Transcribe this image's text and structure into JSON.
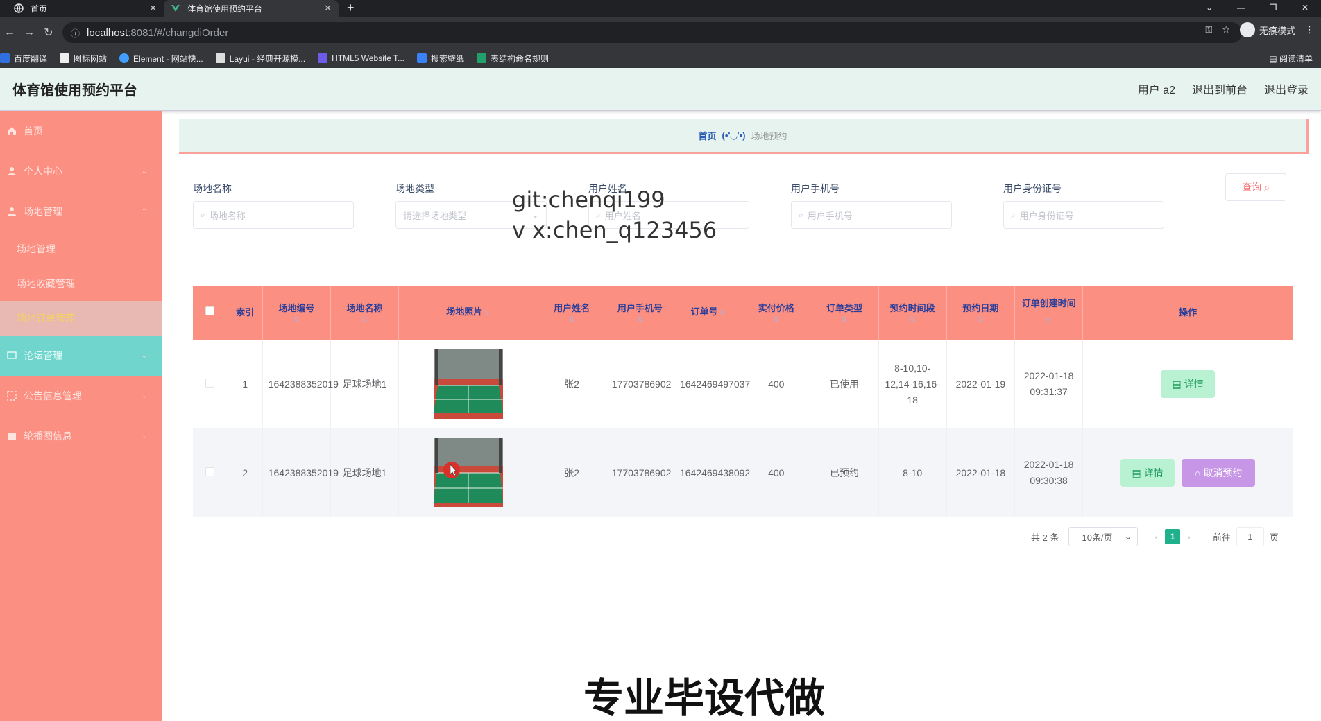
{
  "browser": {
    "tabs": [
      {
        "title": "首页",
        "active": false
      },
      {
        "title": "体育馆使用预约平台",
        "active": true
      }
    ],
    "url_host": "localhost",
    "url_path": ":8081/#/changdiOrder",
    "incognito_label": "无痕模式",
    "bookmarks": [
      "百度翻译",
      "图标网站",
      "Element - 网站快...",
      "Layui - 经典开源模...",
      "HTML5 Website T...",
      "搜索壁纸",
      "表结构命名规则"
    ],
    "reading_list": "阅读清单"
  },
  "header": {
    "title": "体育馆使用预约平台",
    "user": "用户 a2",
    "front_link": "退出到前台",
    "logout_link": "退出登录"
  },
  "sidebar": {
    "home": "首页",
    "personal": "个人中心",
    "venue_mgmt": "场地管理",
    "sub_venue": "场地管理",
    "sub_fav": "场地收藏管理",
    "sub_order": "场地订单管理",
    "forum": "论坛管理",
    "notice": "公告信息管理",
    "carousel": "轮播图信息"
  },
  "breadcrumb": {
    "home": "首页",
    "sep": "(•'◡'•)",
    "current": "场地预约"
  },
  "filters": [
    {
      "label": "场地名称",
      "placeholder": "场地名称"
    },
    {
      "label": "场地类型",
      "placeholder": "请选择场地类型"
    },
    {
      "label": "用户姓名",
      "placeholder": "用户姓名"
    },
    {
      "label": "用户手机号",
      "placeholder": "用户手机号"
    },
    {
      "label": "用户身份证号",
      "placeholder": "用户身份证号"
    }
  ],
  "query_button": "查询",
  "watermark": {
    "line1": "git:chenqi199",
    "line2": "v x:chen_q123456"
  },
  "bottom_mark": "专业毕设代做",
  "table": {
    "headers": [
      "索引",
      "场地编号",
      "场地名称",
      "场地照片",
      "用户姓名",
      "用户手机号",
      "订单号",
      "实付价格",
      "订单类型",
      "预约时间段",
      "预约日期",
      "订单创建时间",
      "操作"
    ],
    "rows": [
      {
        "index": "1",
        "code": "1642388352019",
        "name": "足球场地1",
        "user": "张2",
        "phone": "17703786902",
        "order_no": "1642469497037",
        "price": "400",
        "type": "已使用",
        "slot": "8-10,10-12,14-16,16-18",
        "date": "2022-01-19",
        "created": "2022-01-18 09:31:37",
        "detail": "详情"
      },
      {
        "index": "2",
        "code": "1642388352019",
        "name": "足球场地1",
        "user": "张2",
        "phone": "17703786902",
        "order_no": "1642469438092",
        "price": "400",
        "type": "已预约",
        "slot": "8-10",
        "date": "2022-01-18",
        "created": "2022-01-18 09:30:38",
        "detail": "详情",
        "cancel": "取消预约"
      }
    ]
  },
  "pagination": {
    "total": "共 2 条",
    "page_size": "10条/页",
    "current": "1",
    "goto_prefix": "前往",
    "goto_value": "1",
    "goto_suffix": "页"
  },
  "colors": {
    "sidebar": "#fb8f82",
    "header_bg": "#e6f3ef",
    "accent_teal": "#6fd5cd",
    "page_active": "#1eb18c"
  }
}
